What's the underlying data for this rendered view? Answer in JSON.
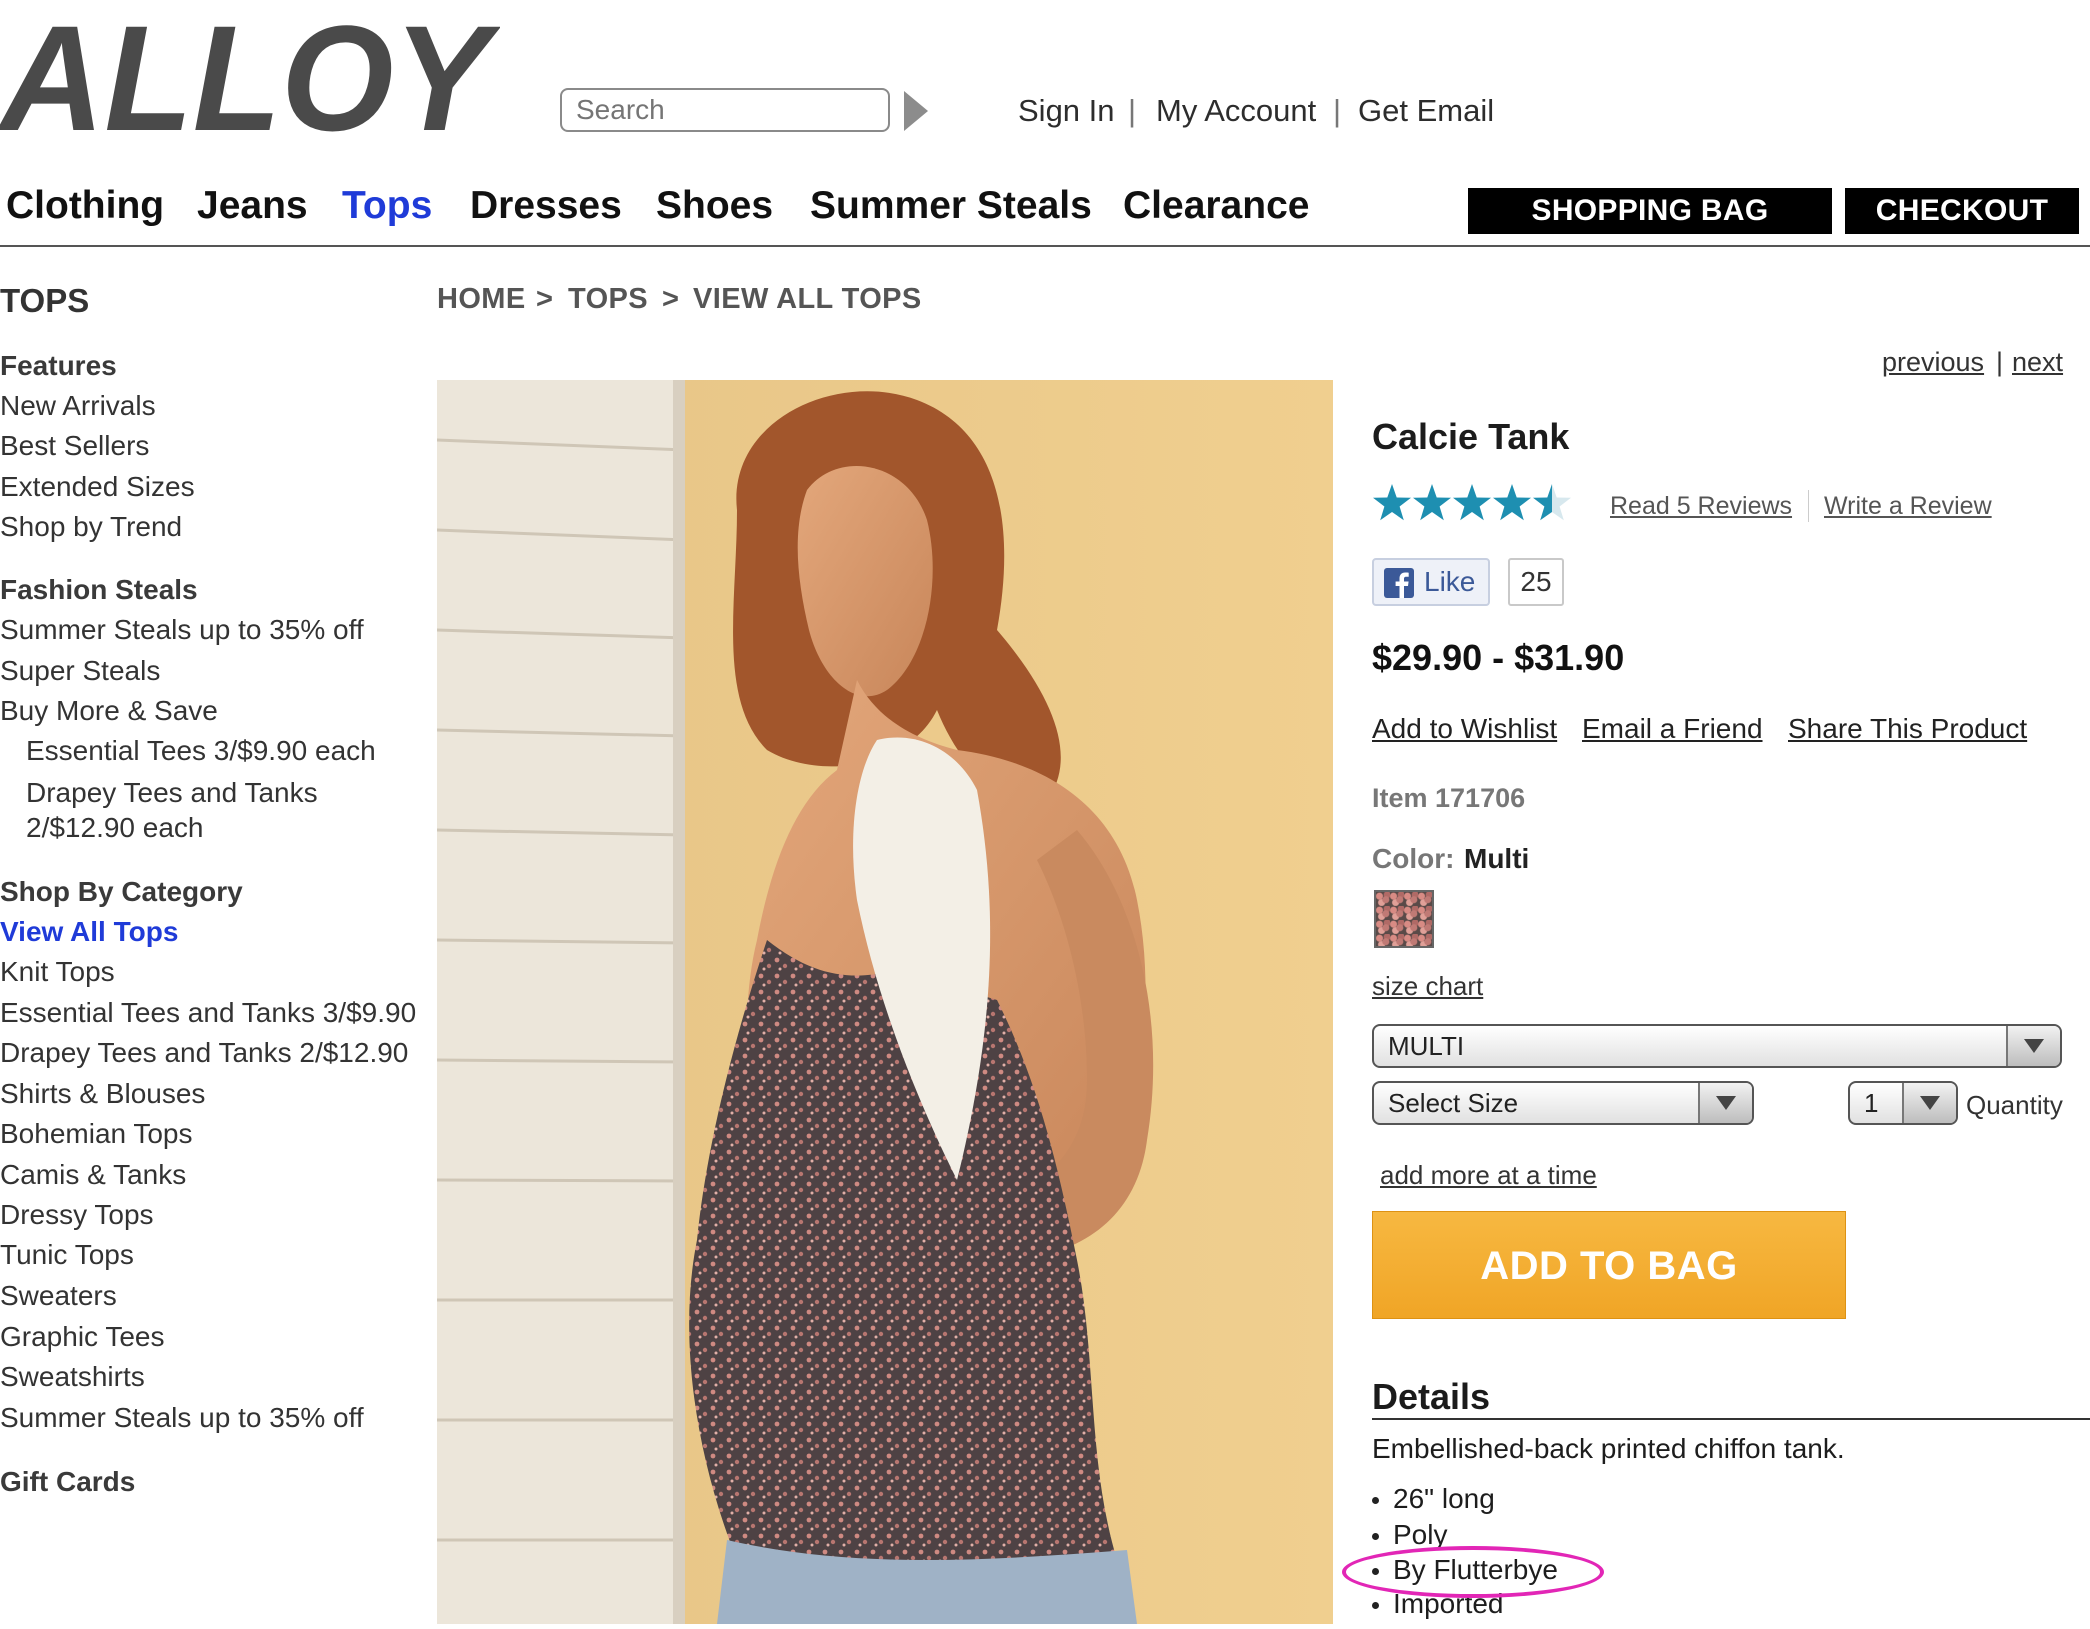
{
  "brand": {
    "logo_text": "ALLOY"
  },
  "header": {
    "search_placeholder": "Search",
    "account_links": [
      "Sign In",
      "My Account",
      "Get Email"
    ],
    "separator": "|"
  },
  "nav": {
    "items": [
      "Clothing",
      "Jeans",
      "Tops",
      "Dresses",
      "Shoes",
      "Summer Steals",
      "Clearance"
    ],
    "active": "Tops",
    "shopping_bag_label": "SHOPPING BAG",
    "checkout_label": "CHECKOUT"
  },
  "sidebar": {
    "title": "TOPS",
    "features_heading": "Features",
    "features": [
      "New Arrivals",
      "Best Sellers",
      "Extended Sizes",
      "Shop by Trend"
    ],
    "fashion_heading": "Fashion Steals",
    "fashion": [
      "Summer Steals up to 35% off",
      "Super Steals",
      "Buy More & Save"
    ],
    "fashion_sub": [
      "Essential Tees 3/$9.90 each",
      "Drapey Tees and Tanks",
      "2/$12.90 each"
    ],
    "category_heading": "Shop By Category",
    "category_active": "View All Tops",
    "categories": [
      "Knit Tops",
      "Essential Tees and Tanks 3/$9.90",
      "Drapey Tees and Tanks 2/$12.90",
      "Shirts & Blouses",
      "Bohemian Tops",
      "Camis & Tanks",
      "Dressy Tops",
      "Tunic Tops",
      "Sweaters",
      "Graphic Tees",
      "Sweatshirts",
      "Summer Steals up to 35% off"
    ],
    "gift_cards": "Gift Cards"
  },
  "breadcrumb": {
    "items": [
      "HOME",
      "TOPS",
      "VIEW ALL TOPS"
    ],
    "separator": ">"
  },
  "pager": {
    "previous": "previous",
    "separator": "|",
    "next": "next"
  },
  "product": {
    "name": "Calcie Tank",
    "rating": 4.5,
    "rating_max": 5,
    "star_color": "#1e8fb1",
    "read_reviews": "Read 5 Reviews",
    "write_review": "Write a Review",
    "like_label": "Like",
    "like_count": "25",
    "price": "$29.90 - $31.90",
    "actions": [
      "Add to Wishlist",
      "Email a Friend",
      "Share This Product"
    ],
    "item_label": "Item 171706",
    "color_label": "Color:",
    "color_value": "Multi",
    "size_chart": "size chart",
    "color_select": "MULTI",
    "size_select": "Select Size",
    "quantity_value": "1",
    "quantity_label": "Quantity",
    "add_more": "add more at a time",
    "add_to_bag": "ADD TO BAG",
    "add_to_bag_color": "#f3ad2f"
  },
  "details": {
    "title": "Details",
    "description": "Embellished-back printed chiffon tank.",
    "bullets": [
      "26\" long",
      "Poly",
      "By Flutterbye",
      "Imported"
    ],
    "highlight_color": "#e226b6"
  }
}
